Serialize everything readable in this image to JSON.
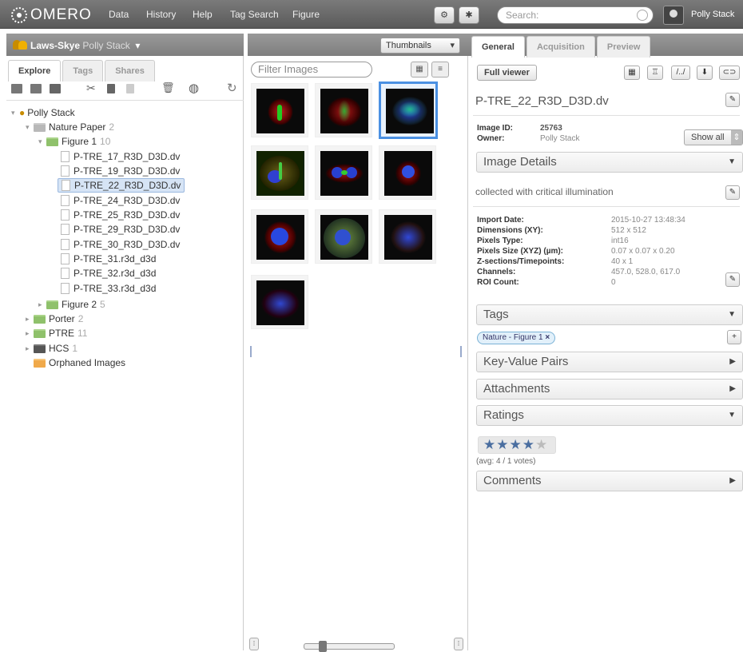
{
  "topbar": {
    "logo": "OMERO",
    "nav": [
      "Data",
      "History",
      "Help",
      "Tag Search",
      "Figure"
    ],
    "search_placeholder": "Search:",
    "user": "Polly Stack"
  },
  "group_bar": {
    "group": "Laws-Skye",
    "user": "Polly Stack"
  },
  "left_tabs": [
    "Explore",
    "Tags",
    "Shares"
  ],
  "tree": {
    "root": "Polly Stack",
    "projects": [
      {
        "name": "Nature Paper",
        "count": "2"
      },
      {
        "name": "Figure 1",
        "count": "10"
      },
      {
        "name": "Figure 2",
        "count": "5"
      },
      {
        "name": "Porter",
        "count": "2"
      },
      {
        "name": "PTRE",
        "count": "11"
      },
      {
        "name": "HCS",
        "count": "1"
      }
    ],
    "images": [
      "P-TRE_17_R3D_D3D.dv",
      "P-TRE_19_R3D_D3D.dv",
      "P-TRE_22_R3D_D3D.dv",
      "P-TRE_24_R3D_D3D.dv",
      "P-TRE_25_R3D_D3D.dv",
      "P-TRE_29_R3D_D3D.dv",
      "P-TRE_30_R3D_D3D.dv",
      "P-TRE_31.r3d_d3d",
      "P-TRE_32.r3d_d3d",
      "P-TRE_33.r3d_d3d"
    ],
    "orphaned": "Orphaned Images"
  },
  "center": {
    "view_mode": "Thumbnails",
    "filter_placeholder": "Filter Images"
  },
  "right_tabs": [
    "General",
    "Acquisition",
    "Preview"
  ],
  "general": {
    "full_viewer": "Full viewer",
    "image_name": "P-TRE_22_R3D_D3D.dv",
    "image_id_label": "Image ID:",
    "image_id": "25763",
    "owner_label": "Owner:",
    "owner": "Polly Stack",
    "show_all": "Show all",
    "image_details": "Image Details",
    "description": "collected with critical illumination",
    "details": [
      {
        "label": "Import Date:",
        "value": "2015-10-27 13:48:34"
      },
      {
        "label": "Dimensions (XY):",
        "value": "512 x 512"
      },
      {
        "label": "Pixels Type:",
        "value": "int16"
      },
      {
        "label": "Pixels Size (XYZ) (µm):",
        "value": "0.07 x 0.07 x 0.20"
      },
      {
        "label": "Z-sections/Timepoints:",
        "value": "40 x 1"
      },
      {
        "label": "Channels:",
        "value": "457.0, 528.0, 617.0"
      },
      {
        "label": "ROI Count:",
        "value": "0"
      }
    ],
    "tags": "Tags",
    "tag_item": "Nature - Figure 1",
    "key_value_pairs": "Key-Value Pairs",
    "attachments": "Attachments",
    "ratings": "Ratings",
    "rating_value": 4,
    "rating_max": 5,
    "rating_avg": "(avg: 4 / 1 votes)",
    "comments": "Comments"
  },
  "colors": {
    "accent": "#4a90e2",
    "topbar": "#666666",
    "tag_bg": "#e2f0fa"
  }
}
